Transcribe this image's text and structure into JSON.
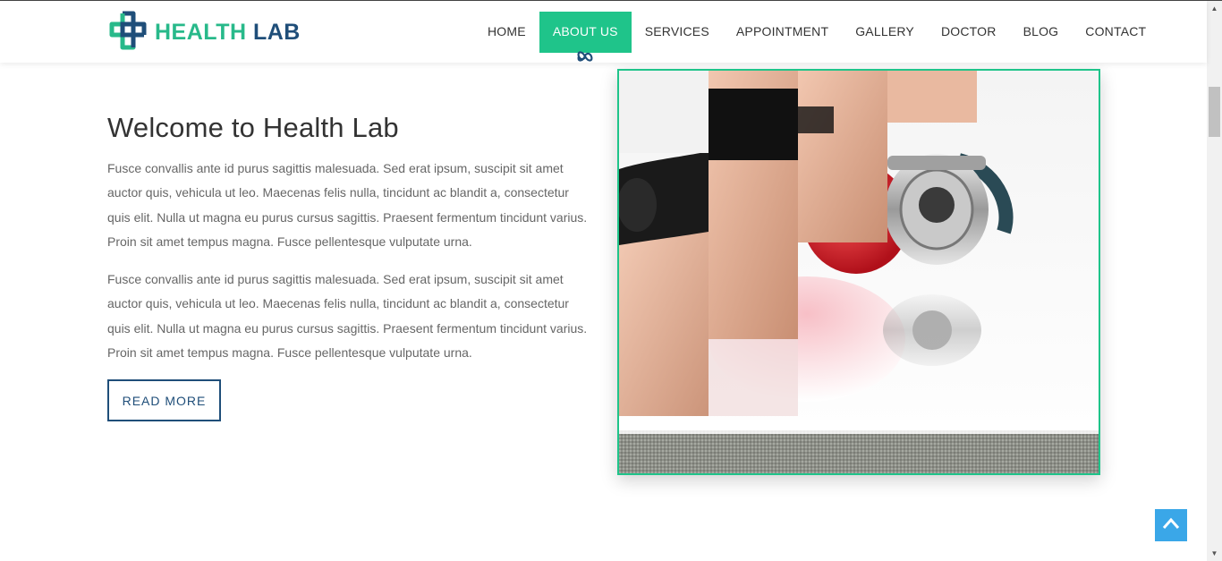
{
  "brand": {
    "name_part1": "HEALTH",
    "name_part2": "LAB",
    "primary": "#28b98a",
    "secondary": "#1f4e79"
  },
  "nav": {
    "items": [
      {
        "label": "HOME",
        "active": false
      },
      {
        "label": "ABOUT US",
        "active": true
      },
      {
        "label": "SERVICES",
        "active": false
      },
      {
        "label": "APPOINTMENT",
        "active": false
      },
      {
        "label": "GALLERY",
        "active": false
      },
      {
        "label": "DOCTOR",
        "active": false
      },
      {
        "label": "BLOG",
        "active": false
      },
      {
        "label": "CONTACT",
        "active": false
      }
    ],
    "active_color": "#1fc48a"
  },
  "about": {
    "title": "Welcome to Health Lab",
    "paragraph1": "Fusce convallis ante id purus sagittis malesuada. Sed erat ipsum, suscipit sit amet auctor quis, vehicula ut leo. Maecenas felis nulla, tincidunt ac blandit a, consectetur quis elit. Nulla ut magna eu purus cursus sagittis. Praesent fermentum tincidunt varius. Proin sit amet tempus magna. Fusce pellentesque vulputate urna.",
    "paragraph2": "Fusce convallis ante id purus sagittis malesuada. Sed erat ipsum, suscipit sit amet auctor quis, vehicula ut leo. Maecenas felis nulla, tincidunt ac blandit a, consectetur quis elit. Nulla ut magna eu purus cursus sagittis. Praesent fermentum tincidunt varius. Proin sit amet tempus magna. Fusce pellentesque vulputate urna.",
    "button_label": "READ MORE"
  },
  "icons": {
    "logo": "medical-cross-logo-icon",
    "nav_active_marker": "infinity-icon",
    "back_to_top": "chevron-up-icon"
  },
  "colors": {
    "frame_border": "#1fc48a",
    "back_to_top_bg": "#3aa7e8"
  }
}
